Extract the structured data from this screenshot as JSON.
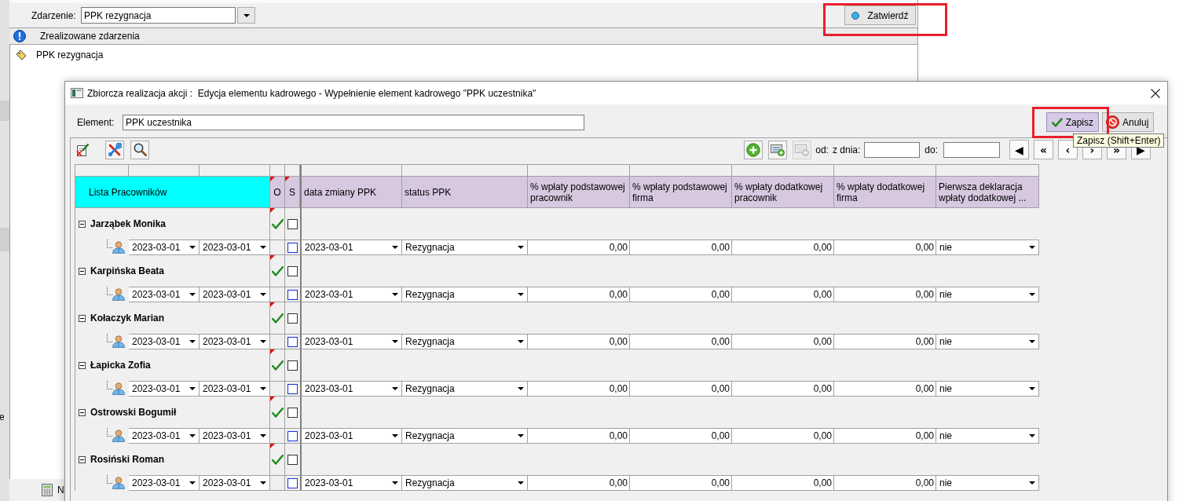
{
  "background_window": {
    "event_label": "Zdarzenie:",
    "event_value": "PPK rezygnacja",
    "confirm_button": {
      "label": "Zatwierdź",
      "highlighted": true
    },
    "list_header": "Zrealizowane zdarzenia",
    "events": [
      {
        "label": "PPK rezygnacja"
      }
    ],
    "side_fragment": "e",
    "status_fragment": "N"
  },
  "dialog": {
    "title": "Zbiorcza realizacja akcji :  Edycja elementu kadrowego - Wypełnienie element kadrowego \"PPK uczestnika\"",
    "element_label": "Element:",
    "element_value": "PPK uczestnika",
    "buttons": [
      {
        "kind": "save",
        "label": "Zapisz",
        "selected": true,
        "highlighted": true
      },
      {
        "kind": "cancel",
        "label": "Anuluj",
        "selected": false,
        "highlighted": false
      }
    ],
    "tooltip": "Zapisz (Shift+Enter)"
  },
  "toolbar": {
    "tools": [
      {
        "kind": "edit"
      },
      {
        "kind": "tools"
      },
      {
        "kind": "search"
      }
    ],
    "actions": [
      {
        "kind": "add",
        "disabled": false
      },
      {
        "kind": "add-record",
        "disabled": false
      },
      {
        "kind": "remove-record",
        "disabled": true
      }
    ],
    "from_label": "od:",
    "from_date_label": "z dnia:",
    "to_label": "do:",
    "nav_buttons": [
      {
        "label": "◀"
      },
      {
        "label": "«"
      },
      {
        "label": "‹"
      },
      {
        "label": "›"
      },
      {
        "label": "»"
      },
      {
        "label": "▶"
      }
    ]
  },
  "table": {
    "group_header": "Lista Pracowników",
    "flag_columns": [
      {
        "label": "O",
        "flagged": true
      },
      {
        "label": "S",
        "flagged": true
      }
    ],
    "columns": [
      "data zmiany PPK",
      "status PPK",
      "% wpłaty podstawowej pracownik",
      "% wpłaty podstawowej firma",
      "% wpłaty dodatkowej pracownik",
      "% wpłaty dodatkowej firma",
      "Pierwsza deklaracja wpłaty dodatkowej ..."
    ],
    "rows": [
      {
        "name": "Jarząbek Monika",
        "expanded": true,
        "flagged": true,
        "o_checked": true,
        "s_checked": false,
        "date_from": "2023-03-01",
        "date_to": "2023-03-01",
        "detail_s_checked": false,
        "change_date": "2023-03-01",
        "status": "Rezygnacja",
        "amounts": [
          "0,00",
          "0,00",
          "0,00",
          "0,00"
        ],
        "first_declaration": "nie"
      },
      {
        "name": "Karpińska Beata",
        "expanded": true,
        "flagged": true,
        "o_checked": true,
        "s_checked": false,
        "date_from": "2023-03-01",
        "date_to": "2023-03-01",
        "detail_s_checked": false,
        "change_date": "2023-03-01",
        "status": "Rezygnacja",
        "amounts": [
          "0,00",
          "0,00",
          "0,00",
          "0,00"
        ],
        "first_declaration": "nie"
      },
      {
        "name": "Kołaczyk Marian",
        "expanded": true,
        "flagged": true,
        "o_checked": true,
        "s_checked": false,
        "date_from": "2023-03-01",
        "date_to": "2023-03-01",
        "detail_s_checked": false,
        "change_date": "2023-03-01",
        "status": "Rezygnacja",
        "amounts": [
          "0,00",
          "0,00",
          "0,00",
          "0,00"
        ],
        "first_declaration": "nie"
      },
      {
        "name": "Łapicka Zofia",
        "expanded": true,
        "flagged": true,
        "o_checked": true,
        "s_checked": false,
        "date_from": "2023-03-01",
        "date_to": "2023-03-01",
        "detail_s_checked": false,
        "change_date": "2023-03-01",
        "status": "Rezygnacja",
        "amounts": [
          "0,00",
          "0,00",
          "0,00",
          "0,00"
        ],
        "first_declaration": "nie"
      },
      {
        "name": "Ostrowski Bogumił",
        "expanded": true,
        "flagged": true,
        "o_checked": true,
        "s_checked": false,
        "date_from": "2023-03-01",
        "date_to": "2023-03-01",
        "detail_s_checked": false,
        "change_date": "2023-03-01",
        "status": "Rezygnacja",
        "amounts": [
          "0,00",
          "0,00",
          "0,00",
          "0,00"
        ],
        "first_declaration": "nie"
      },
      {
        "name": "Rosiński Roman",
        "expanded": true,
        "flagged": true,
        "o_checked": true,
        "s_checked": false,
        "date_from": "2023-03-01",
        "date_to": "2023-03-01",
        "detail_s_checked": false,
        "change_date": "2023-03-01",
        "status": "Rezygnacja",
        "amounts": [
          "0,00",
          "0,00",
          "0,00",
          "0,00"
        ],
        "first_declaration": "nie"
      }
    ]
  }
}
